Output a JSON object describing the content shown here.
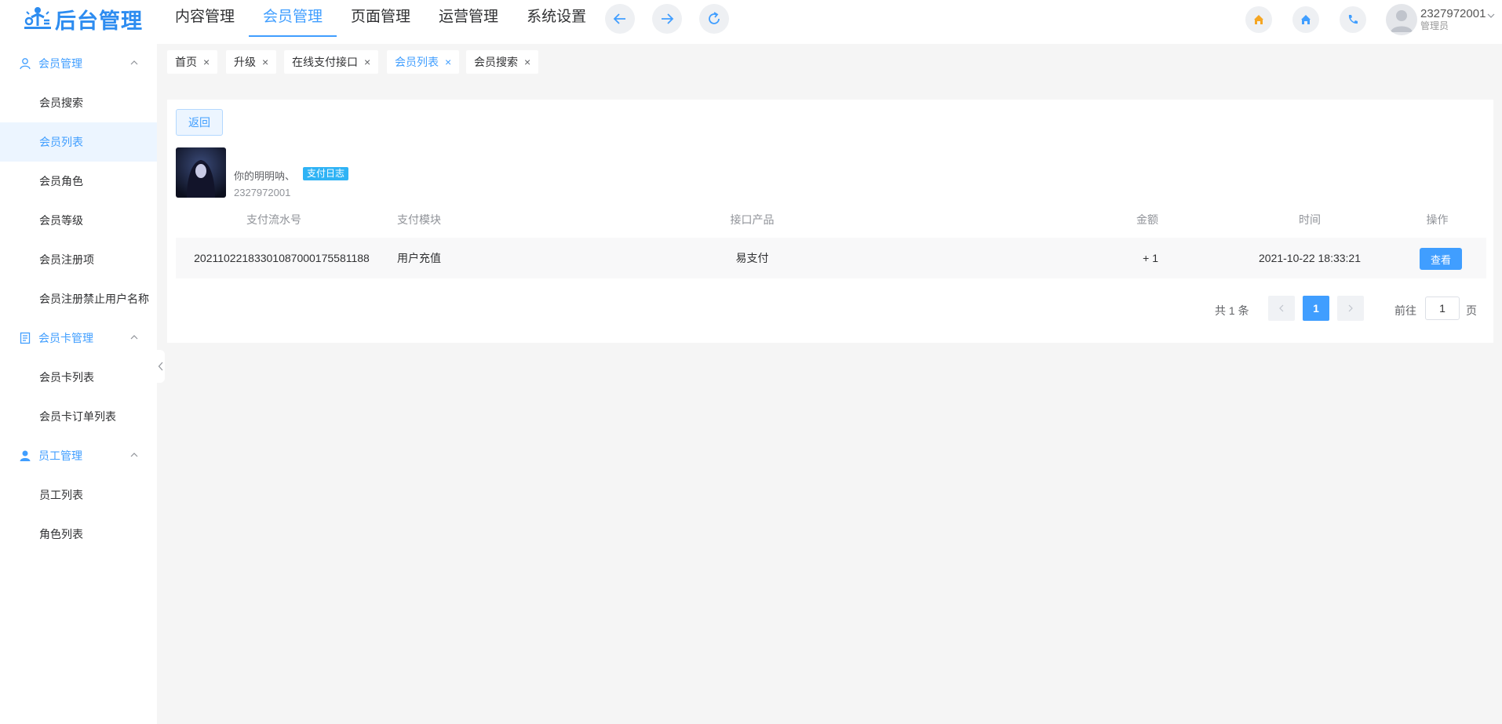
{
  "header": {
    "logo_text": "后台管理",
    "nav": [
      {
        "label": "内容管理",
        "active": false
      },
      {
        "label": "会员管理",
        "active": true
      },
      {
        "label": "页面管理",
        "active": false
      },
      {
        "label": "运营管理",
        "active": false
      },
      {
        "label": "系统设置",
        "active": false
      }
    ],
    "user": {
      "id": "2327972001",
      "role": "管理员"
    }
  },
  "sidebar": {
    "groups": [
      {
        "label": "会员管理",
        "icon": "user-icon",
        "items": [
          "会员搜索",
          "会员列表",
          "会员角色",
          "会员等级",
          "会员注册项",
          "会员注册禁止用户名称"
        ]
      },
      {
        "label": "会员卡管理",
        "icon": "card-icon",
        "items": [
          "会员卡列表",
          "会员卡订单列表"
        ]
      },
      {
        "label": "员工管理",
        "icon": "person-icon",
        "items": [
          "员工列表",
          "角色列表"
        ]
      }
    ],
    "active_item": "会员列表"
  },
  "tags": [
    {
      "label": "首页",
      "active": false
    },
    {
      "label": "升级",
      "active": false
    },
    {
      "label": "在线支付接口",
      "active": false
    },
    {
      "label": "会员列表",
      "active": true
    },
    {
      "label": "会员搜索",
      "active": false
    }
  ],
  "content": {
    "back_label": "返回",
    "profile": {
      "name": "你的明明呐、",
      "badge": "支付日志",
      "id": "2327972001"
    },
    "table": {
      "headers": [
        "支付流水号",
        "支付模块",
        "接口产品",
        "金额",
        "时间",
        "操作"
      ],
      "rows": [
        {
          "serial": "20211022183301087000175581188",
          "module": "用户充值",
          "product": "易支付",
          "amount": "+ 1",
          "time": "2021-10-22 18:33:21",
          "action": "查看"
        }
      ]
    },
    "pagination": {
      "total": "共 1 条",
      "current": "1",
      "goto_label": "前往",
      "goto_value": "1",
      "goto_suffix": "页"
    }
  },
  "colors": {
    "accent": "#409eff",
    "badge": "#2fb3f5",
    "home_orange": "#f5a623"
  }
}
